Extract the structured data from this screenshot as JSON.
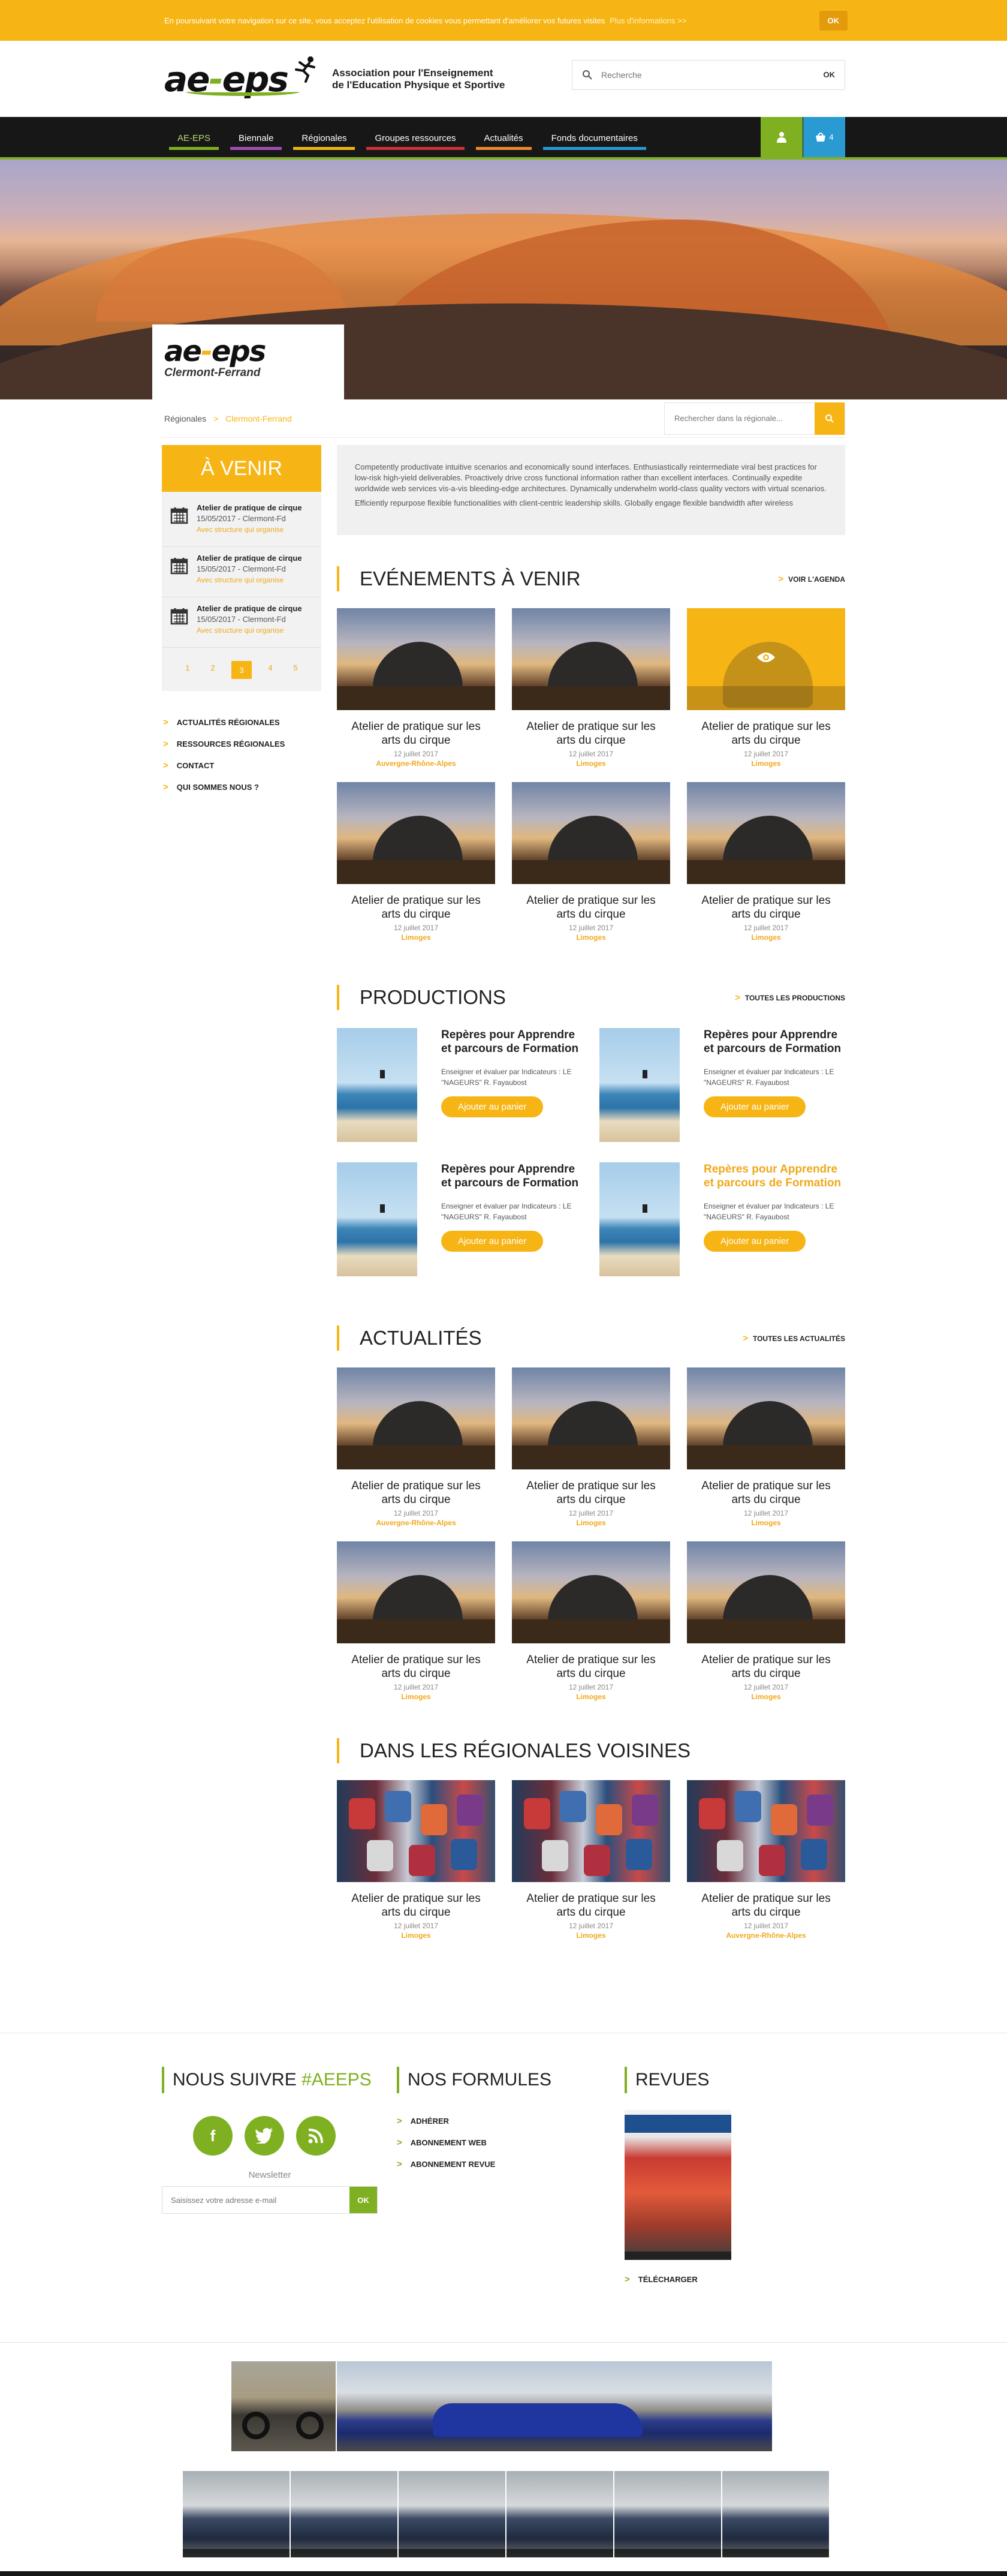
{
  "cookie": {
    "text": "En poursuivant votre navigation sur ce site, vous acceptez l'utilisation de cookies vous permettant d'améliorer vos futures visites",
    "link": "Plus d'informations >>",
    "ok": "OK"
  },
  "header": {
    "logo_text": "ae-eps",
    "tagline_1": "Association pour l'Enseignement",
    "tagline_2": "de l'Education Physique et Sportive",
    "search_placeholder": "Recherche",
    "search_ok": "OK"
  },
  "nav": {
    "items": [
      {
        "label": "AE-EPS",
        "color": "#7fb021"
      },
      {
        "label": "Biennale",
        "color": "#a24fb4"
      },
      {
        "label": "Régionales",
        "color": "#e8b810"
      },
      {
        "label": "Groupes ressources",
        "color": "#d2303a"
      },
      {
        "label": "Actualités",
        "color": "#ef8a2a"
      },
      {
        "label": "Fonds documentaires",
        "color": "#2a9ad3"
      }
    ],
    "cart_count": "4"
  },
  "hero": {
    "logo_text": "ae-eps",
    "city": "Clermont-Ferrand"
  },
  "breadcrumb": {
    "parent": "Régionales",
    "current": "Clermont-Ferrand",
    "search_placeholder": "Rechercher dans la régionale..."
  },
  "sidebar": {
    "upcoming_title": "À VENIR",
    "events": [
      {
        "title": "Atelier de pratique de cirque",
        "date": "15/05/2017 - Clermont-Fd",
        "status": "Avec structure qui organise"
      },
      {
        "title": "Atelier de pratique de cirque",
        "date": "15/05/2017 - Clermont-Fd",
        "status": "Avec structure qui organise"
      },
      {
        "title": "Atelier de pratique de cirque",
        "date": "15/05/2017 - Clermont-Fd",
        "status": "Avec structure qui organise"
      }
    ],
    "pages": [
      "1",
      "2",
      "3",
      "4",
      "5"
    ],
    "current_page": "3",
    "links": [
      "Actualités régionales",
      "Ressources régionales",
      "Contact",
      "Qui sommes nous ?"
    ]
  },
  "intro": {
    "p1": "Competently productivate intuitive scenarios and economically sound interfaces. Enthusiastically reintermediate viral best practices for low-risk high-yield deliverables. Proactively drive cross functional information rather than excellent interfaces. Continually expedite worldwide web services vis-a-vis bleeding-edge architectures. Dynamically underwhelm world-class quality vectors with virtual scenarios.",
    "p2": "Efficiently repurpose flexible functionalities with client-centric leadership skills. Globally engage flexible bandwidth after wireless"
  },
  "events_section": {
    "title": "Evénements à venir",
    "more": "Voir l'agenda",
    "cards": [
      {
        "title": "Atelier de pratique sur les arts du cirque",
        "date": "12 juillet 2017",
        "location": "Auvergne-Rhône-Alpes"
      },
      {
        "title": "Atelier de pratique sur les arts du cirque",
        "date": "12 juillet 2017",
        "location": "Limoges"
      },
      {
        "title": "Atelier de pratique sur les arts du cirque",
        "date": "12 juillet 2017",
        "location": "Limoges"
      },
      {
        "title": "Atelier de pratique sur les arts du cirque",
        "date": "12 juillet 2017",
        "location": "Limoges"
      },
      {
        "title": "Atelier de pratique sur les arts du cirque",
        "date": "12 juillet 2017",
        "location": "Limoges"
      },
      {
        "title": "Atelier de pratique sur les arts du cirque",
        "date": "12 juillet 2017",
        "location": "Limoges"
      }
    ]
  },
  "productions_section": {
    "title": "Productions",
    "more": "Toutes les productions",
    "items": [
      {
        "title": "Repères pour Apprendre et parcours de Formation",
        "desc": "Enseigner et évaluer par Indicateurs : LE \"NAGEURS\" R. Fayaubost",
        "button": "Ajouter au panier"
      },
      {
        "title": "Repères pour Apprendre et parcours de Formation",
        "desc": "Enseigner et évaluer par Indicateurs : LE \"NAGEURS\" R. Fayaubost",
        "button": "Ajouter au panier"
      },
      {
        "title": "Repères pour Apprendre et parcours de Formation",
        "desc": "Enseigner et évaluer par Indicateurs : LE \"NAGEURS\" R. Fayaubost",
        "button": "Ajouter au panier"
      },
      {
        "title": "Repères pour Apprendre et parcours de Formation",
        "desc": "Enseigner et évaluer par Indicateurs : LE \"NAGEURS\" R. Fayaubost",
        "button": "Ajouter au panier"
      }
    ]
  },
  "news_section": {
    "title": "Actualités",
    "more": "Toutes les actualités",
    "cards": [
      {
        "title": "Atelier de pratique sur les arts du cirque",
        "date": "12 juillet 2017",
        "location": "Auvergne-Rhône-Alpes"
      },
      {
        "title": "Atelier de pratique sur les arts du cirque",
        "date": "12 juillet 2017",
        "location": "Limoges"
      },
      {
        "title": "Atelier de pratique sur les arts du cirque",
        "date": "12 juillet 2017",
        "location": "Limoges"
      },
      {
        "title": "Atelier de pratique sur les arts du cirque",
        "date": "12 juillet 2017",
        "location": "Limoges"
      },
      {
        "title": "Atelier de pratique sur les arts du cirque",
        "date": "12 juillet 2017",
        "location": "Limoges"
      },
      {
        "title": "Atelier de pratique sur les arts du cirque",
        "date": "12 juillet 2017",
        "location": "Limoges"
      }
    ]
  },
  "neighbors_section": {
    "title": "Dans les régionales voisines",
    "cards": [
      {
        "title": "Atelier de pratique sur les arts du cirque",
        "date": "12 juillet 2017",
        "location": "Limoges"
      },
      {
        "title": "Atelier de pratique sur les arts du cirque",
        "date": "12 juillet 2017",
        "location": "Limoges"
      },
      {
        "title": "Atelier de pratique sur les arts du cirque",
        "date": "12 juillet 2017",
        "location": "Auvergne-Rhône-Alpes"
      }
    ]
  },
  "footer": {
    "follow_title": "Nous suivre",
    "follow_tag": "#AEEPS",
    "newsletter_label": "Newsletter",
    "newsletter_placeholder": "Saisissez votre adresse e-mail",
    "newsletter_ok": "OK",
    "formulas_title": "Nos formules",
    "formulas": [
      "Adhérer",
      "Abonnement web",
      "Abonnement revue"
    ],
    "revues_title": "Revues",
    "download": "Télécharger"
  }
}
